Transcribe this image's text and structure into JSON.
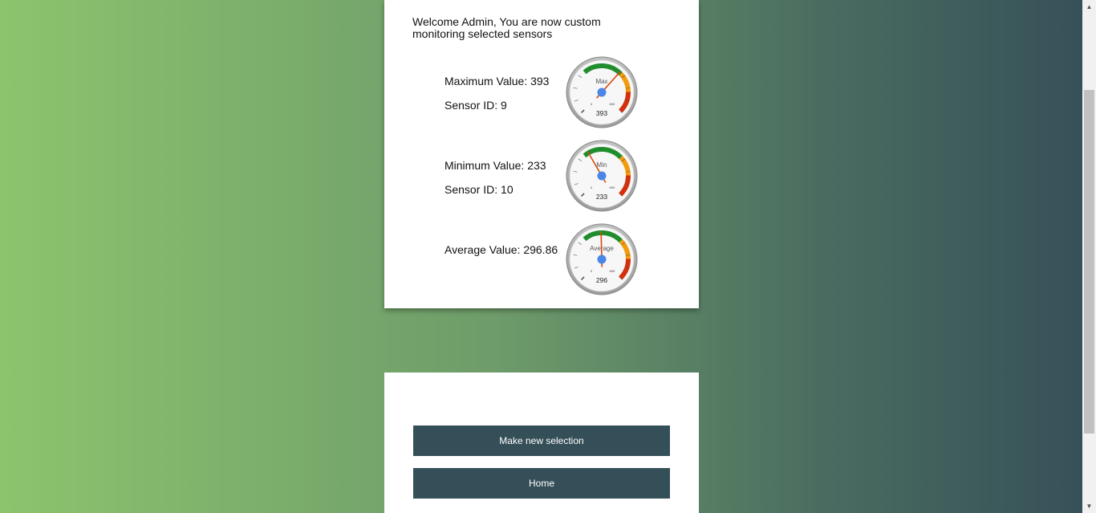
{
  "welcome_text": "Welcome Admin, You are now custom monitoring selected sensors",
  "sensors": [
    {
      "value_label": "Maximum Value: 393",
      "id_label": "Sensor ID: 9",
      "gauge": {
        "title": "Max",
        "value": 393,
        "display": "393",
        "min": 0,
        "max": 600,
        "min_tick": "0",
        "max_tick": "600"
      }
    },
    {
      "value_label": "Minimum Value: 233",
      "id_label": "Sensor ID: 10",
      "gauge": {
        "title": "Min",
        "value": 233,
        "display": "233",
        "min": 0,
        "max": 600,
        "min_tick": "0",
        "max_tick": "600"
      }
    },
    {
      "value_label": "Average Value: 296.86",
      "id_label": "",
      "gauge": {
        "title": "Average",
        "value": 296.86,
        "display": "296",
        "min": 0,
        "max": 600,
        "min_tick": "0",
        "max_tick": "600"
      }
    }
  ],
  "buttons": {
    "new_selection": "Make new selection",
    "home": "Home"
  },
  "colors": {
    "button_bg": "#354f58",
    "gauge_green": "#1f8f2b",
    "gauge_orange": "#f29b0f",
    "gauge_red": "#d4300b",
    "needle": "#d9480f",
    "hub": "#4a86e8"
  }
}
